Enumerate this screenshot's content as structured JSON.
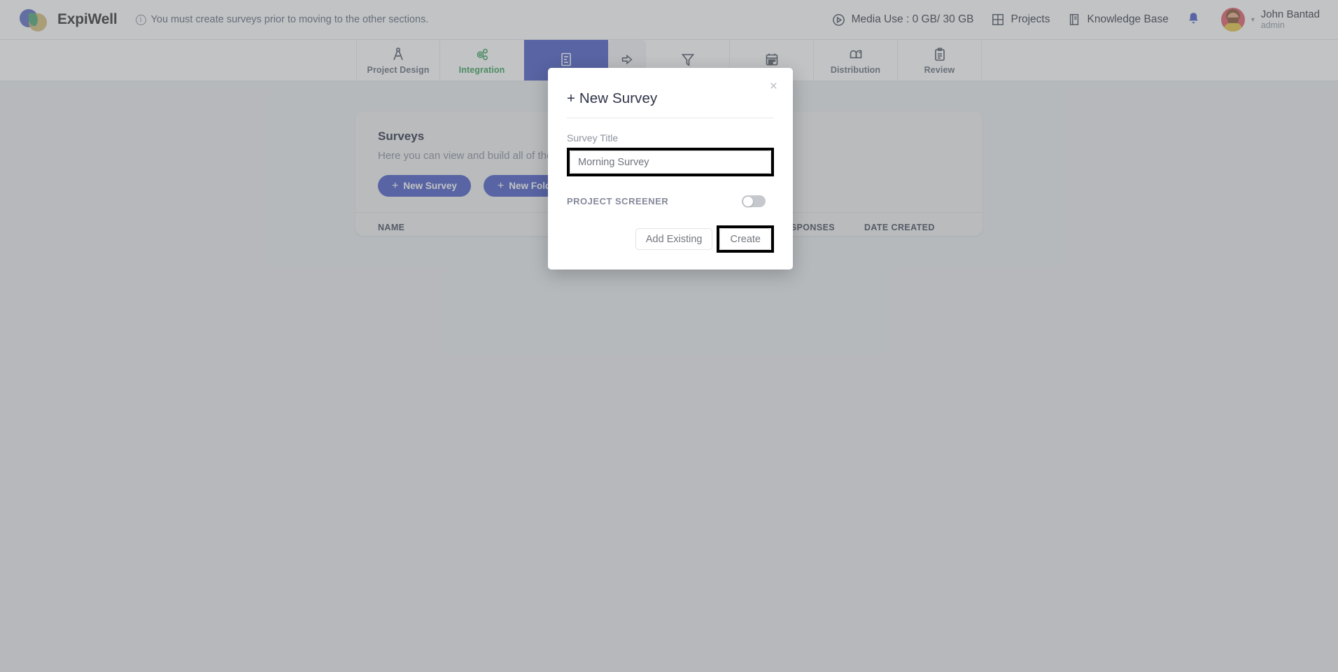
{
  "header": {
    "brand": "ExpiWell",
    "logo_icon": "expiwell-logo-icon",
    "notice": "You must create surveys prior to moving to the other sections.",
    "notice_icon": "info-circle-icon",
    "media_use": "Media Use : 0 GB/ 30 GB",
    "media_icon": "play-circle-icon",
    "projects": "Projects",
    "projects_icon": "grid-icon",
    "knowledge_base": "Knowledge Base",
    "knowledge_icon": "book-icon",
    "bell_icon": "notification-bell-icon",
    "avatar_icon": "user-avatar",
    "caret_icon": "chevron-down-icon",
    "user_name": "John Bantad",
    "user_role": "admin"
  },
  "nav": {
    "tabs": [
      {
        "label": "Project Design",
        "icon": "compass-icon",
        "state": "default"
      },
      {
        "label": "Integration",
        "icon": "gears-icon",
        "state": "green"
      },
      {
        "label": "",
        "icon": "survey-document-icon",
        "state": "active"
      },
      {
        "label": "",
        "icon": "arrow-right-icon",
        "state": "sub"
      },
      {
        "label": "",
        "icon": "funnel-filter-icon",
        "state": "default"
      },
      {
        "label": "",
        "icon": "calendar-icon",
        "state": "default"
      },
      {
        "label": "Distribution",
        "icon": "mailbox-icon",
        "state": "default"
      },
      {
        "label": "Review",
        "icon": "clipboard-icon",
        "state": "default"
      }
    ]
  },
  "surveys_card": {
    "title": "Surveys",
    "subtitle": "Here you can view and build all of the",
    "new_survey": "New Survey",
    "new_folder": "New Folder",
    "plus": "+",
    "columns": {
      "name": "NAME",
      "mid": "",
      "responses": "RESPONSES",
      "date_created": "DATE CREATED"
    }
  },
  "modal": {
    "title": "+ New Survey",
    "close_icon": "close-icon",
    "close_glyph": "×",
    "field_label": "Survey Title",
    "title_value": "Morning Survey",
    "title_placeholder": "Survey Title",
    "screener_label": "PROJECT SCREENER",
    "screener_on": false,
    "add_existing": "Add Existing",
    "create": "Create"
  },
  "colors": {
    "accent": "#5161c6",
    "green": "#3fa45c",
    "page_bg": "#eceef0",
    "highlight": "#000000"
  }
}
